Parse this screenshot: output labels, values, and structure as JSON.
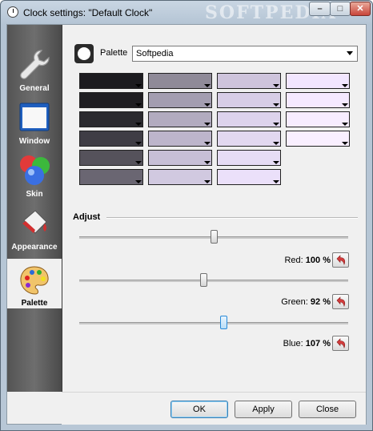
{
  "window": {
    "title": "Clock settings: \"Default Clock\"",
    "watermark": "SOFTPEDIA",
    "minimize_glyph": "–",
    "maximize_glyph": "□",
    "close_glyph": "✕"
  },
  "sidebar": {
    "items": [
      {
        "label": "General",
        "icon": "wrench-icon"
      },
      {
        "label": "Window",
        "icon": "window-icon"
      },
      {
        "label": "Skin",
        "icon": "skin-bubbles-icon"
      },
      {
        "label": "Appearance",
        "icon": "paint-bucket-icon"
      },
      {
        "label": "Palette",
        "icon": "palette-icon",
        "active": true
      }
    ]
  },
  "palette": {
    "label": "Palette",
    "selected": "Softpedia",
    "swatches": {
      "col1": [
        "#1c1b1f",
        "#1f1e22",
        "#2b2a2f",
        "#3f3d45",
        "#55525b",
        "#6a6672"
      ],
      "col2": [
        "#8f8a98",
        "#a39db0",
        "#b2abbf",
        "#bdb5cb",
        "#c7bfd6",
        "#d1c9e0"
      ],
      "col3": [
        "#cec4dc",
        "#d7cde6",
        "#ddd3ec",
        "#e2d8f0",
        "#e6dcf5",
        "#ebe0fa"
      ],
      "col4": [
        "#f2e6ff",
        "#f5e9ff",
        "#f7ecff",
        "#f9efff"
      ]
    }
  },
  "adjust": {
    "label": "Adjust",
    "sliders": [
      {
        "name": "Red",
        "label": "Red:",
        "value": "100 %",
        "level": 0.5
      },
      {
        "name": "Green",
        "label": "Green:",
        "value": "92 %",
        "level": 0.46
      },
      {
        "name": "Blue",
        "label": "Blue:",
        "value": "107 %",
        "level": 0.535
      }
    ]
  },
  "buttons": {
    "ok": "OK",
    "apply": "Apply",
    "close": "Close"
  },
  "colors": {
    "accent": "#3c7fb1",
    "reset_arrow": "#d23b3b"
  }
}
